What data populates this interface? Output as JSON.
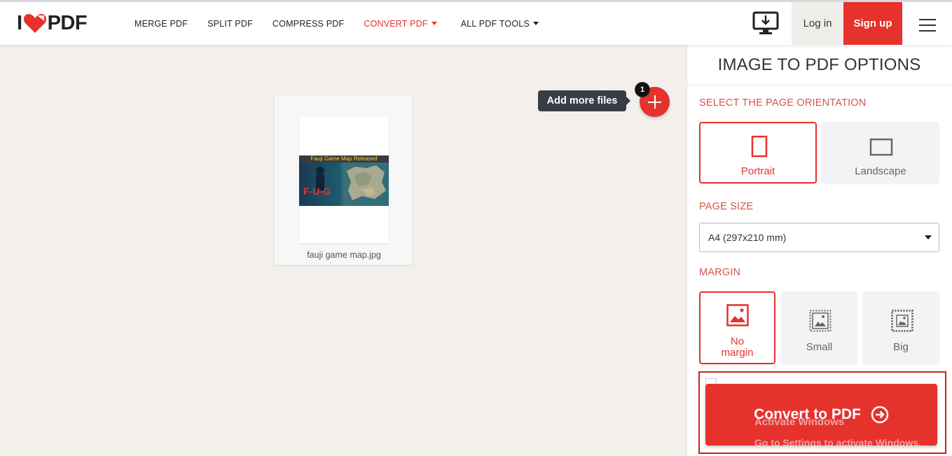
{
  "header": {
    "logo_left": "I",
    "logo_right": "PDF",
    "nav": [
      {
        "label": "MERGE PDF"
      },
      {
        "label": "SPLIT PDF"
      },
      {
        "label": "COMPRESS PDF"
      },
      {
        "label": "CONVERT PDF"
      },
      {
        "label": "ALL PDF TOOLS"
      }
    ],
    "login_label": "Log in",
    "signup_label": "Sign up",
    "accent_color": "#e5322d"
  },
  "workspace": {
    "file": {
      "name": "fauji game map.jpg",
      "image_banner": "Fauji Game Map Released",
      "image_logo": "F-U-G"
    },
    "add_tooltip": "Add more files",
    "file_count": "1"
  },
  "sidebar": {
    "title": "IMAGE TO PDF OPTIONS",
    "orientation_label": "SELECT THE PAGE ORIENTATION",
    "orientation_options": [
      {
        "label": "Portrait",
        "selected": true
      },
      {
        "label": "Landscape",
        "selected": false
      }
    ],
    "page_size_label": "PAGE SIZE",
    "page_size_value": "A4 (297x210 mm)",
    "margin_label": "MARGIN",
    "margin_options": [
      {
        "label": "No margin",
        "selected": true
      },
      {
        "label": "Small",
        "selected": false
      },
      {
        "label": "Big",
        "selected": false
      }
    ],
    "convert_label": "Convert to PDF",
    "watermark_line1": "Activate Windows",
    "watermark_line2": "Go to Settings to activate Windows."
  }
}
